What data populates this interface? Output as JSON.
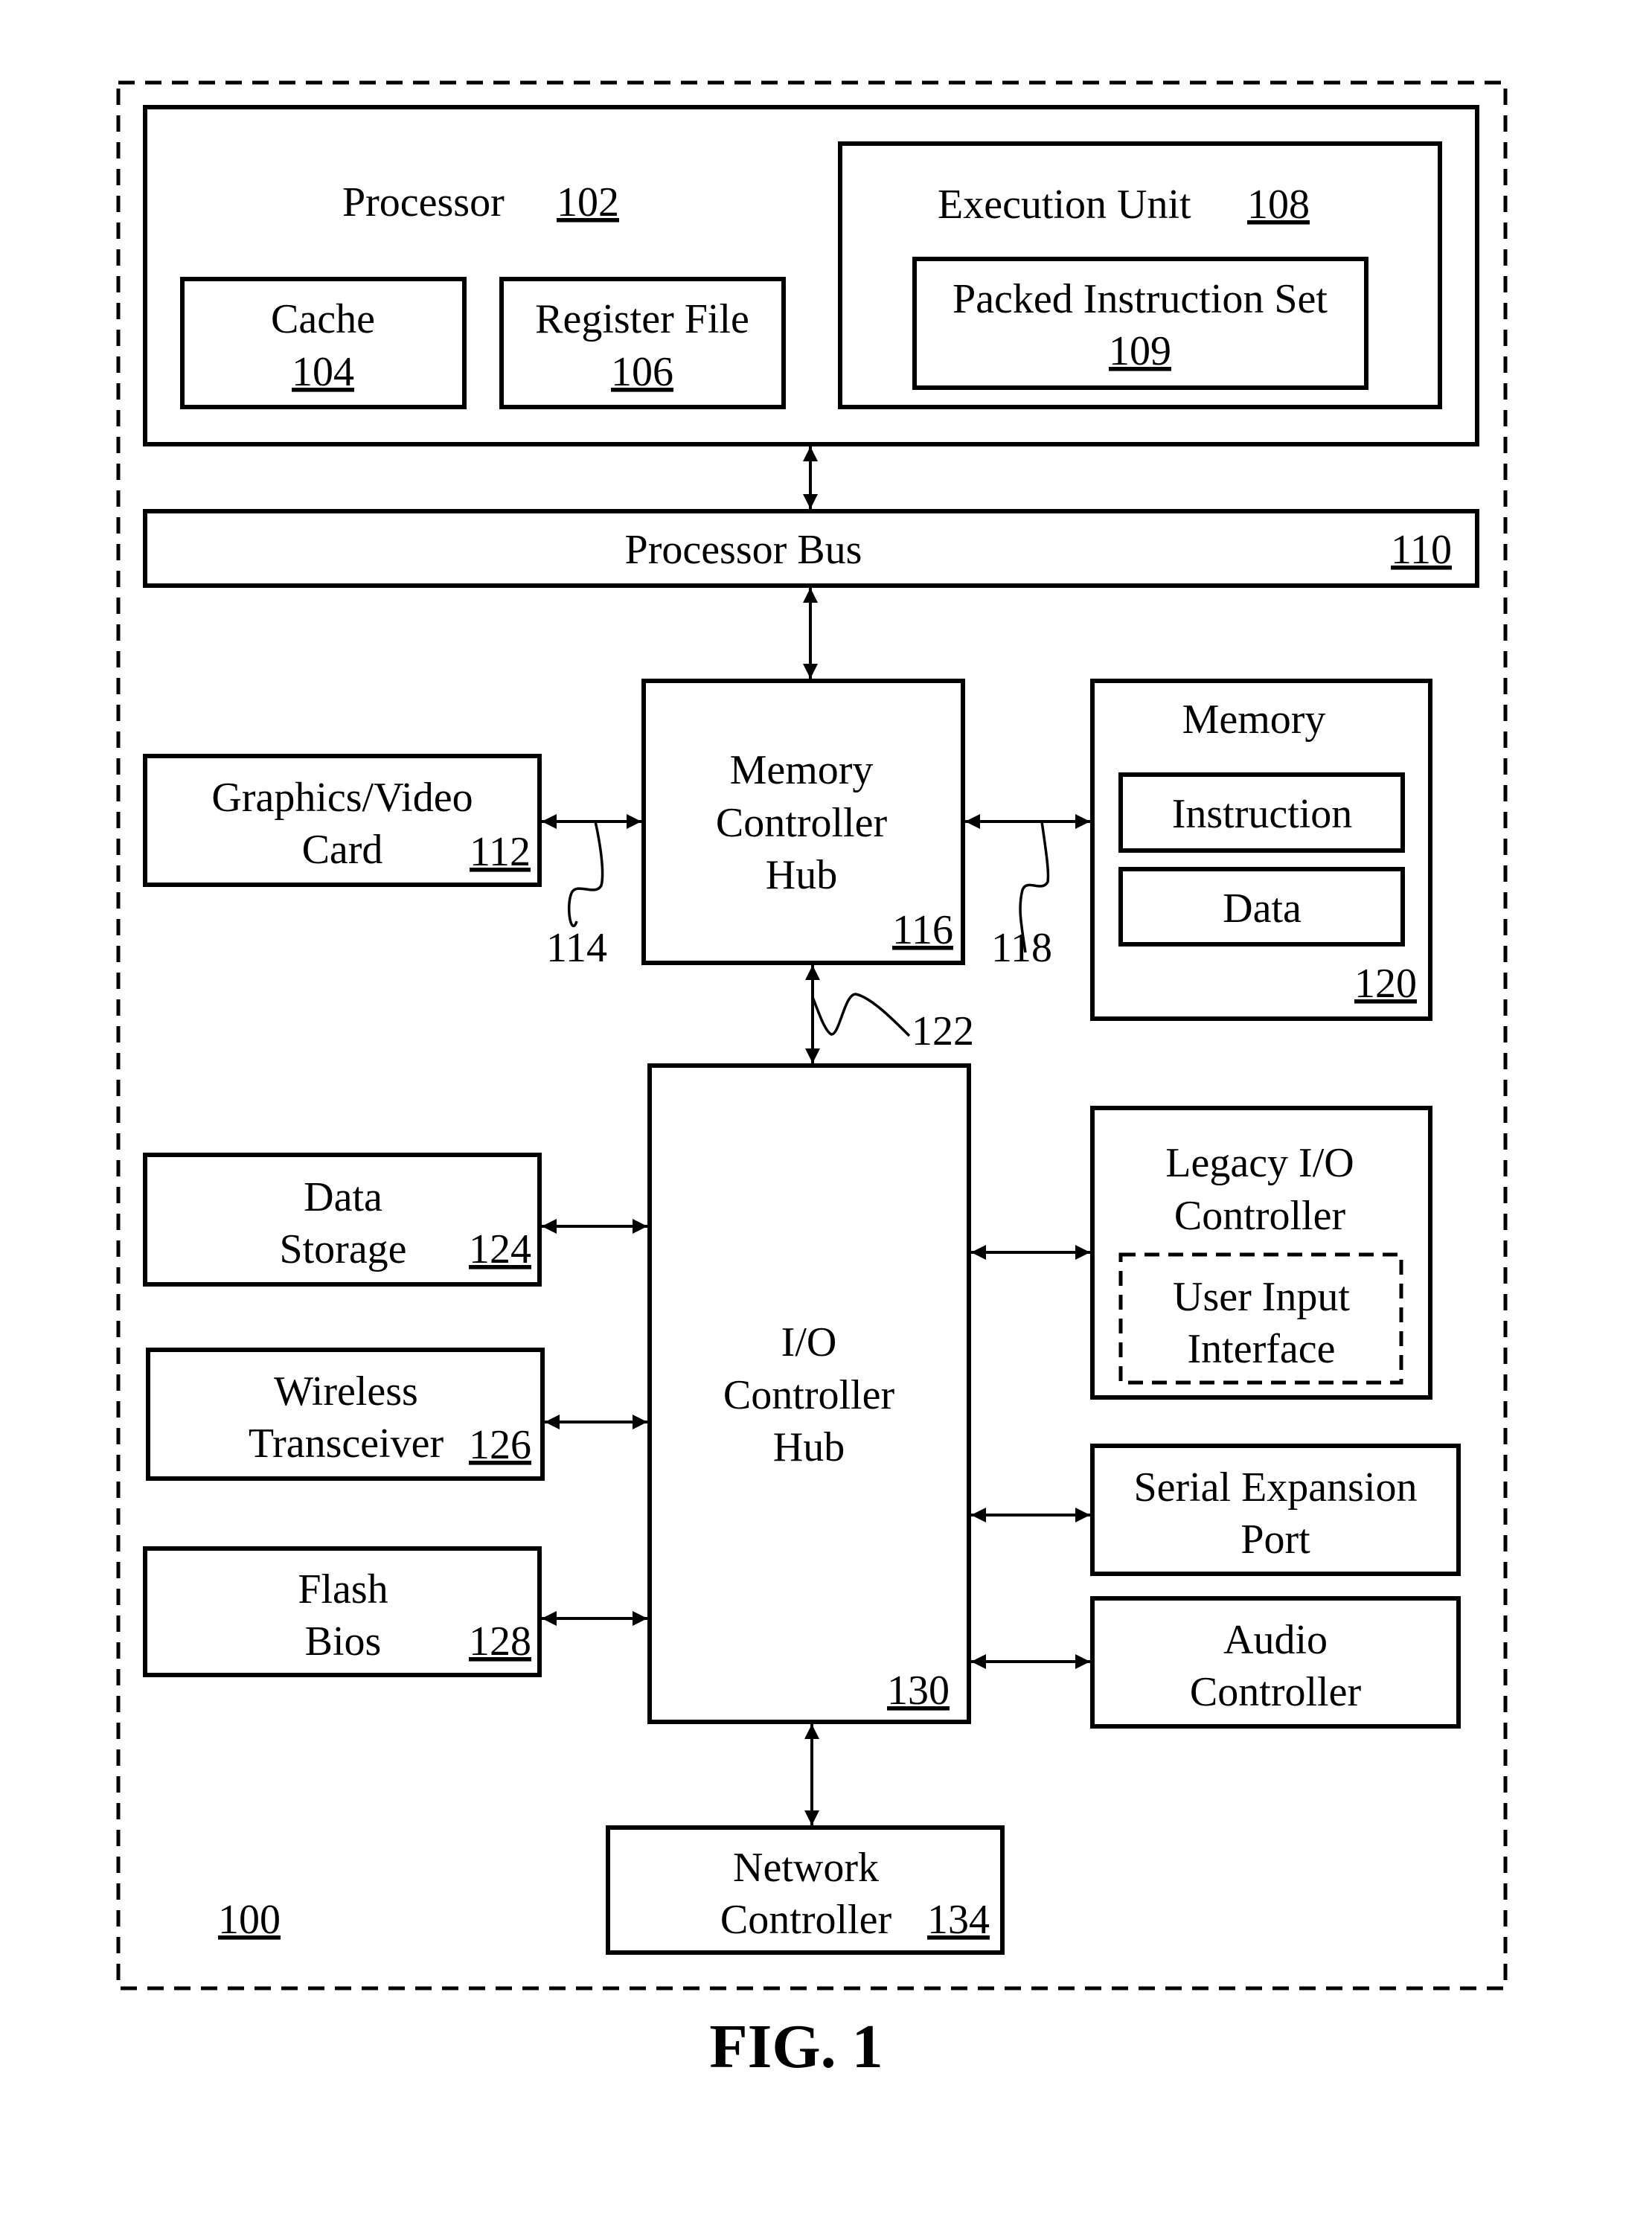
{
  "figure": {
    "caption": "FIG. 1",
    "system_ref": "100"
  },
  "processor": {
    "label": "Processor",
    "ref": "102",
    "cache": {
      "label": "Cache",
      "ref": "104"
    },
    "register_file": {
      "label": "Register File",
      "ref": "106"
    },
    "execution_unit": {
      "label": "Execution Unit",
      "ref": "108",
      "packed_instruction_set": {
        "label": "Packed Instruction Set",
        "ref": "109"
      }
    }
  },
  "processor_bus": {
    "label": "Processor Bus",
    "ref": "110"
  },
  "graphics_card": {
    "line1": "Graphics/Video",
    "line2": "Card",
    "ref": "112"
  },
  "link_114": "114",
  "memory_controller_hub": {
    "line1": "Memory",
    "line2": "Controller",
    "line3": "Hub",
    "ref": "116"
  },
  "link_118": "118",
  "memory": {
    "label": "Memory",
    "ref": "120",
    "instruction": "Instruction",
    "data": "Data"
  },
  "link_122": "122",
  "data_storage": {
    "line1": "Data",
    "line2": "Storage",
    "ref": "124"
  },
  "wireless_transceiver": {
    "line1": "Wireless",
    "line2": "Transceiver",
    "ref": "126"
  },
  "flash_bios": {
    "line1": "Flash",
    "line2": "Bios",
    "ref": "128"
  },
  "io_controller_hub": {
    "line1": "I/O",
    "line2": "Controller",
    "line3": "Hub",
    "ref": "130"
  },
  "legacy_io_controller": {
    "line1": "Legacy I/O",
    "line2": "Controller",
    "user_input": {
      "line1": "User Input",
      "line2": "Interface"
    }
  },
  "serial_expansion_port": {
    "line1": "Serial Expansion",
    "line2": "Port"
  },
  "audio_controller": {
    "line1": "Audio",
    "line2": "Controller"
  },
  "network_controller": {
    "line1": "Network",
    "line2": "Controller",
    "ref": "134"
  }
}
